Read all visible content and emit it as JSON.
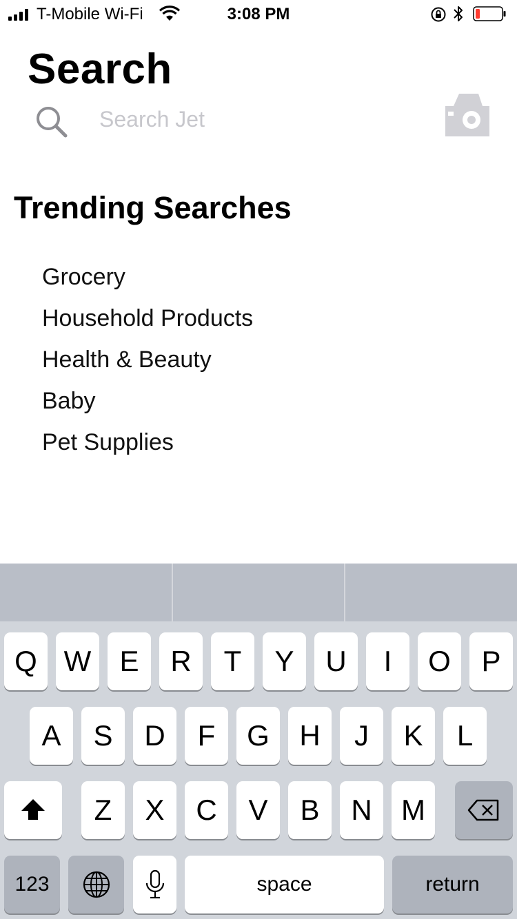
{
  "status_bar": {
    "carrier": "T-Mobile Wi-Fi",
    "time": "3:08 PM",
    "battery_color": "#ff3b30"
  },
  "header": {
    "title": "Search",
    "search_placeholder": "Search Jet"
  },
  "trending": {
    "title": "Trending Searches",
    "items": [
      "Grocery",
      "Household Products",
      "Health & Beauty",
      "Baby",
      "Pet Supplies"
    ]
  },
  "keyboard": {
    "row1": [
      "Q",
      "W",
      "E",
      "R",
      "T",
      "Y",
      "U",
      "I",
      "O",
      "P"
    ],
    "row2": [
      "A",
      "S",
      "D",
      "F",
      "G",
      "H",
      "J",
      "K",
      "L"
    ],
    "row3": [
      "Z",
      "X",
      "C",
      "V",
      "B",
      "N",
      "M"
    ],
    "numbers_label": "123",
    "space_label": "space",
    "return_label": "return"
  }
}
